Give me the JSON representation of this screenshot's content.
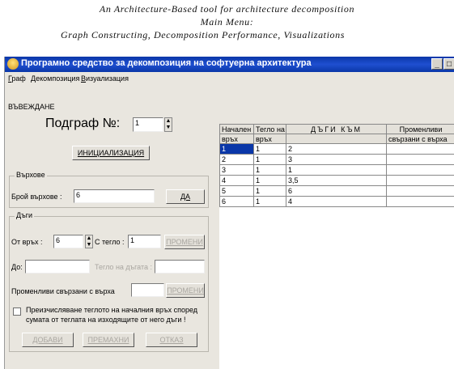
{
  "caption": {
    "line1": "An Architecture-Based tool for architecture decomposition",
    "line2": "Main Menu:",
    "line3": "Graph Constructing, Decomposition Performance, Visualizations"
  },
  "window": {
    "title": "Програмно средство за декомпозиция на софтуерна архитектура",
    "btn_min": "_",
    "btn_max": "□"
  },
  "menu": {
    "items": [
      {
        "accel": "Г",
        "rest": "раф"
      },
      {
        "accel": "Д",
        "rest": "екомпозиция"
      },
      {
        "accel": "В",
        "rest": "изуализация"
      }
    ]
  },
  "input_section": {
    "heading": "ВЪВЕЖДАНЕ",
    "subgraph_label": "Подграф №:",
    "subgraph_value": "1",
    "init_button": "ИНИЦИАЛИЗАЦИЯ"
  },
  "vertices": {
    "title": "Върхове",
    "count_label": "Брой върхове :",
    "count_value": "6",
    "yes_button": "ДА"
  },
  "arcs": {
    "title": "Дъги",
    "from_label": "От връх :",
    "from_value": "6",
    "weight_label": "С тегло :",
    "weight_value": "1",
    "change_button": "ПРОМЕНИ",
    "to_label": "До:",
    "to_value": "",
    "arc_weight_label": "Тегло на дъгата :",
    "arc_weight_value": "",
    "vars_label": "Променливи свързани с върха",
    "vars_value": "",
    "vars_change_button": "ПРОМЕНИ",
    "checkbox_line1": "Преизчисляване теглото на началния връх според",
    "checkbox_line2": "сумата от теглата на изходящите от него дъги !",
    "add_button": "ДОБАВИ",
    "remove_button": "ПРЕМАХНИ",
    "cancel_button": "ОТКАЗ"
  },
  "table": {
    "headers_row1": [
      "Начален",
      "Тегло на",
      "ДЪГИ КЪМ",
      "Променливи"
    ],
    "headers_row2": [
      "връх",
      "връх",
      "",
      "свързани с върха"
    ],
    "rows": [
      [
        "1",
        "1",
        "2",
        ""
      ],
      [
        "2",
        "1",
        "3",
        ""
      ],
      [
        "3",
        "1",
        "1",
        ""
      ],
      [
        "4",
        "1",
        "3,5",
        ""
      ],
      [
        "5",
        "1",
        "6",
        ""
      ],
      [
        "6",
        "1",
        "4",
        ""
      ]
    ]
  },
  "colors": {
    "titlebar": "#0a37a8",
    "window_bg": "#e9e6df",
    "selection": "#0a37a8"
  }
}
